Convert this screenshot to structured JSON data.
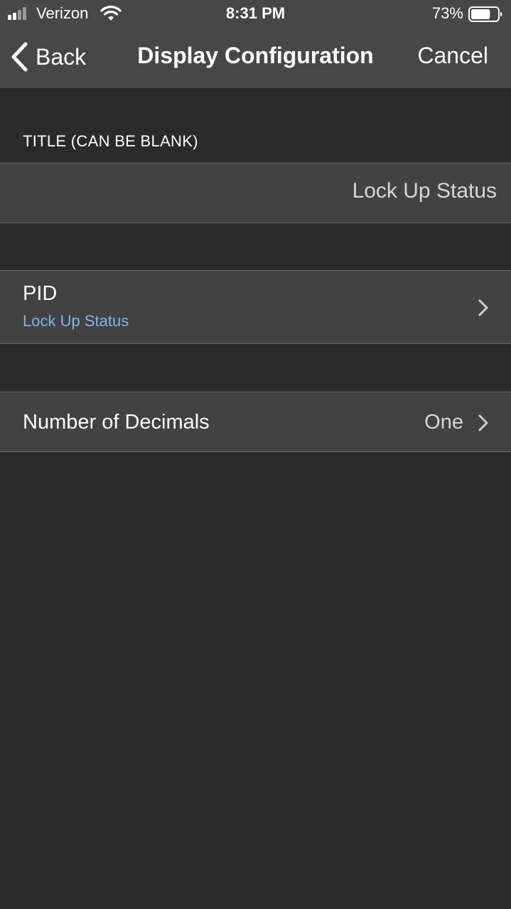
{
  "status_bar": {
    "carrier": "Verizon",
    "time": "8:31 PM",
    "battery_percent": "73%",
    "battery_level": 0.73
  },
  "nav": {
    "back_label": "Back",
    "title": "Display Configuration",
    "cancel_label": "Cancel"
  },
  "title_section": {
    "header": "TITLE (CAN BE BLANK)",
    "value": "Lock Up Status"
  },
  "pid_row": {
    "label": "PID",
    "subtitle": "Lock Up Status"
  },
  "decimals_row": {
    "label": "Number of Decimals",
    "value": "One"
  },
  "colors": {
    "background": "#2a2a2a",
    "bar": "#474747",
    "cell": "#424242",
    "accent_link": "#7eb5e8"
  }
}
